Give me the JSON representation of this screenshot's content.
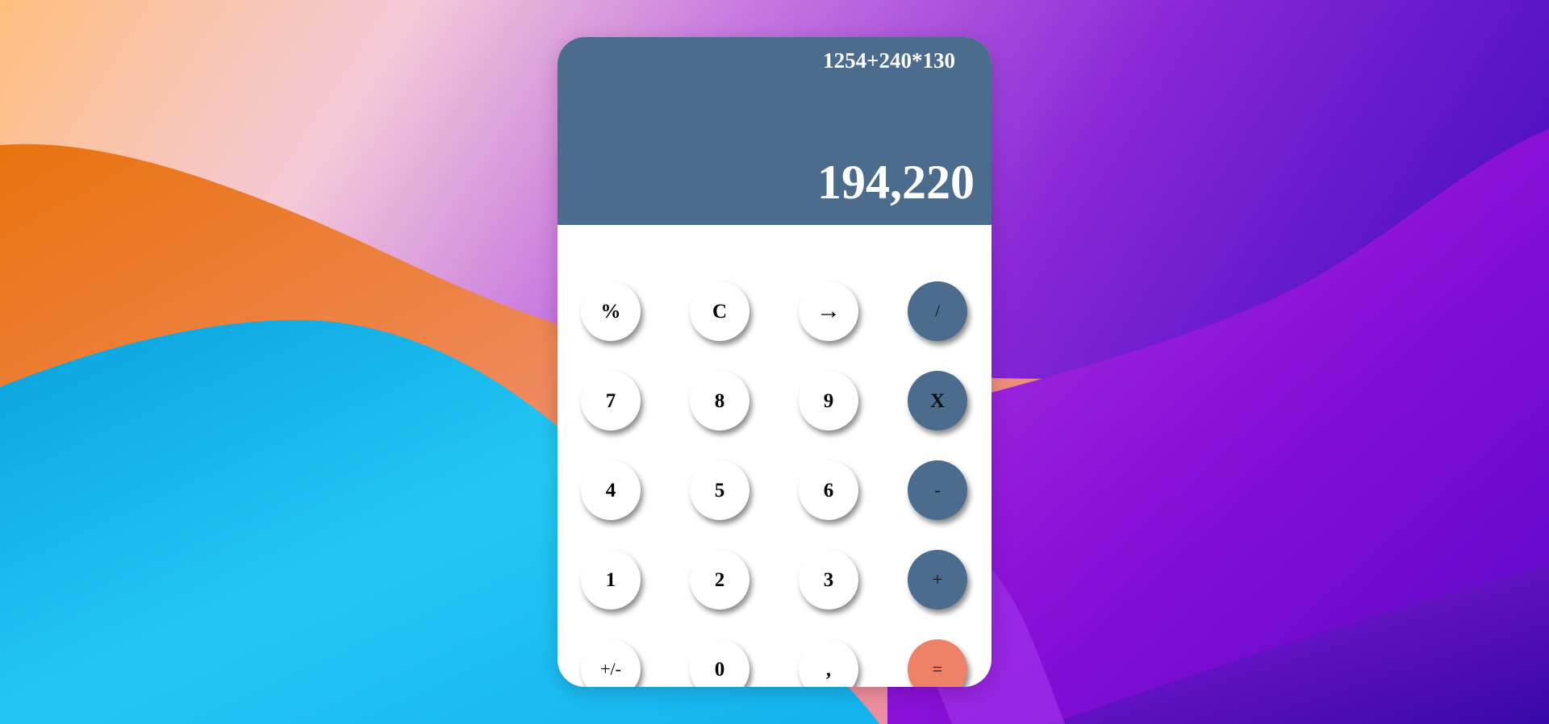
{
  "calculator": {
    "expression": "1254+240*130",
    "result": "194,220",
    "colors": {
      "display_background": "#4c6c8e",
      "operator_key": "#4c6c8e",
      "equals_key": "#ee8168",
      "digit_key": "#ffffff"
    },
    "keys": {
      "percent": "%",
      "clear": "C",
      "backspace": "→",
      "divide": "/",
      "seven": "7",
      "eight": "8",
      "nine": "9",
      "multiply": "X",
      "four": "4",
      "five": "5",
      "six": "6",
      "subtract": "-",
      "one": "1",
      "two": "2",
      "three": "3",
      "add": "+",
      "negate": "+/-",
      "zero": "0",
      "decimal": ",",
      "equals": "="
    }
  },
  "wallpaper": {
    "colors": [
      "#ffb37a",
      "#f07b2c",
      "#1fb8ec",
      "#9a2de0",
      "#6a0fd4",
      "#3a0bb0"
    ]
  }
}
